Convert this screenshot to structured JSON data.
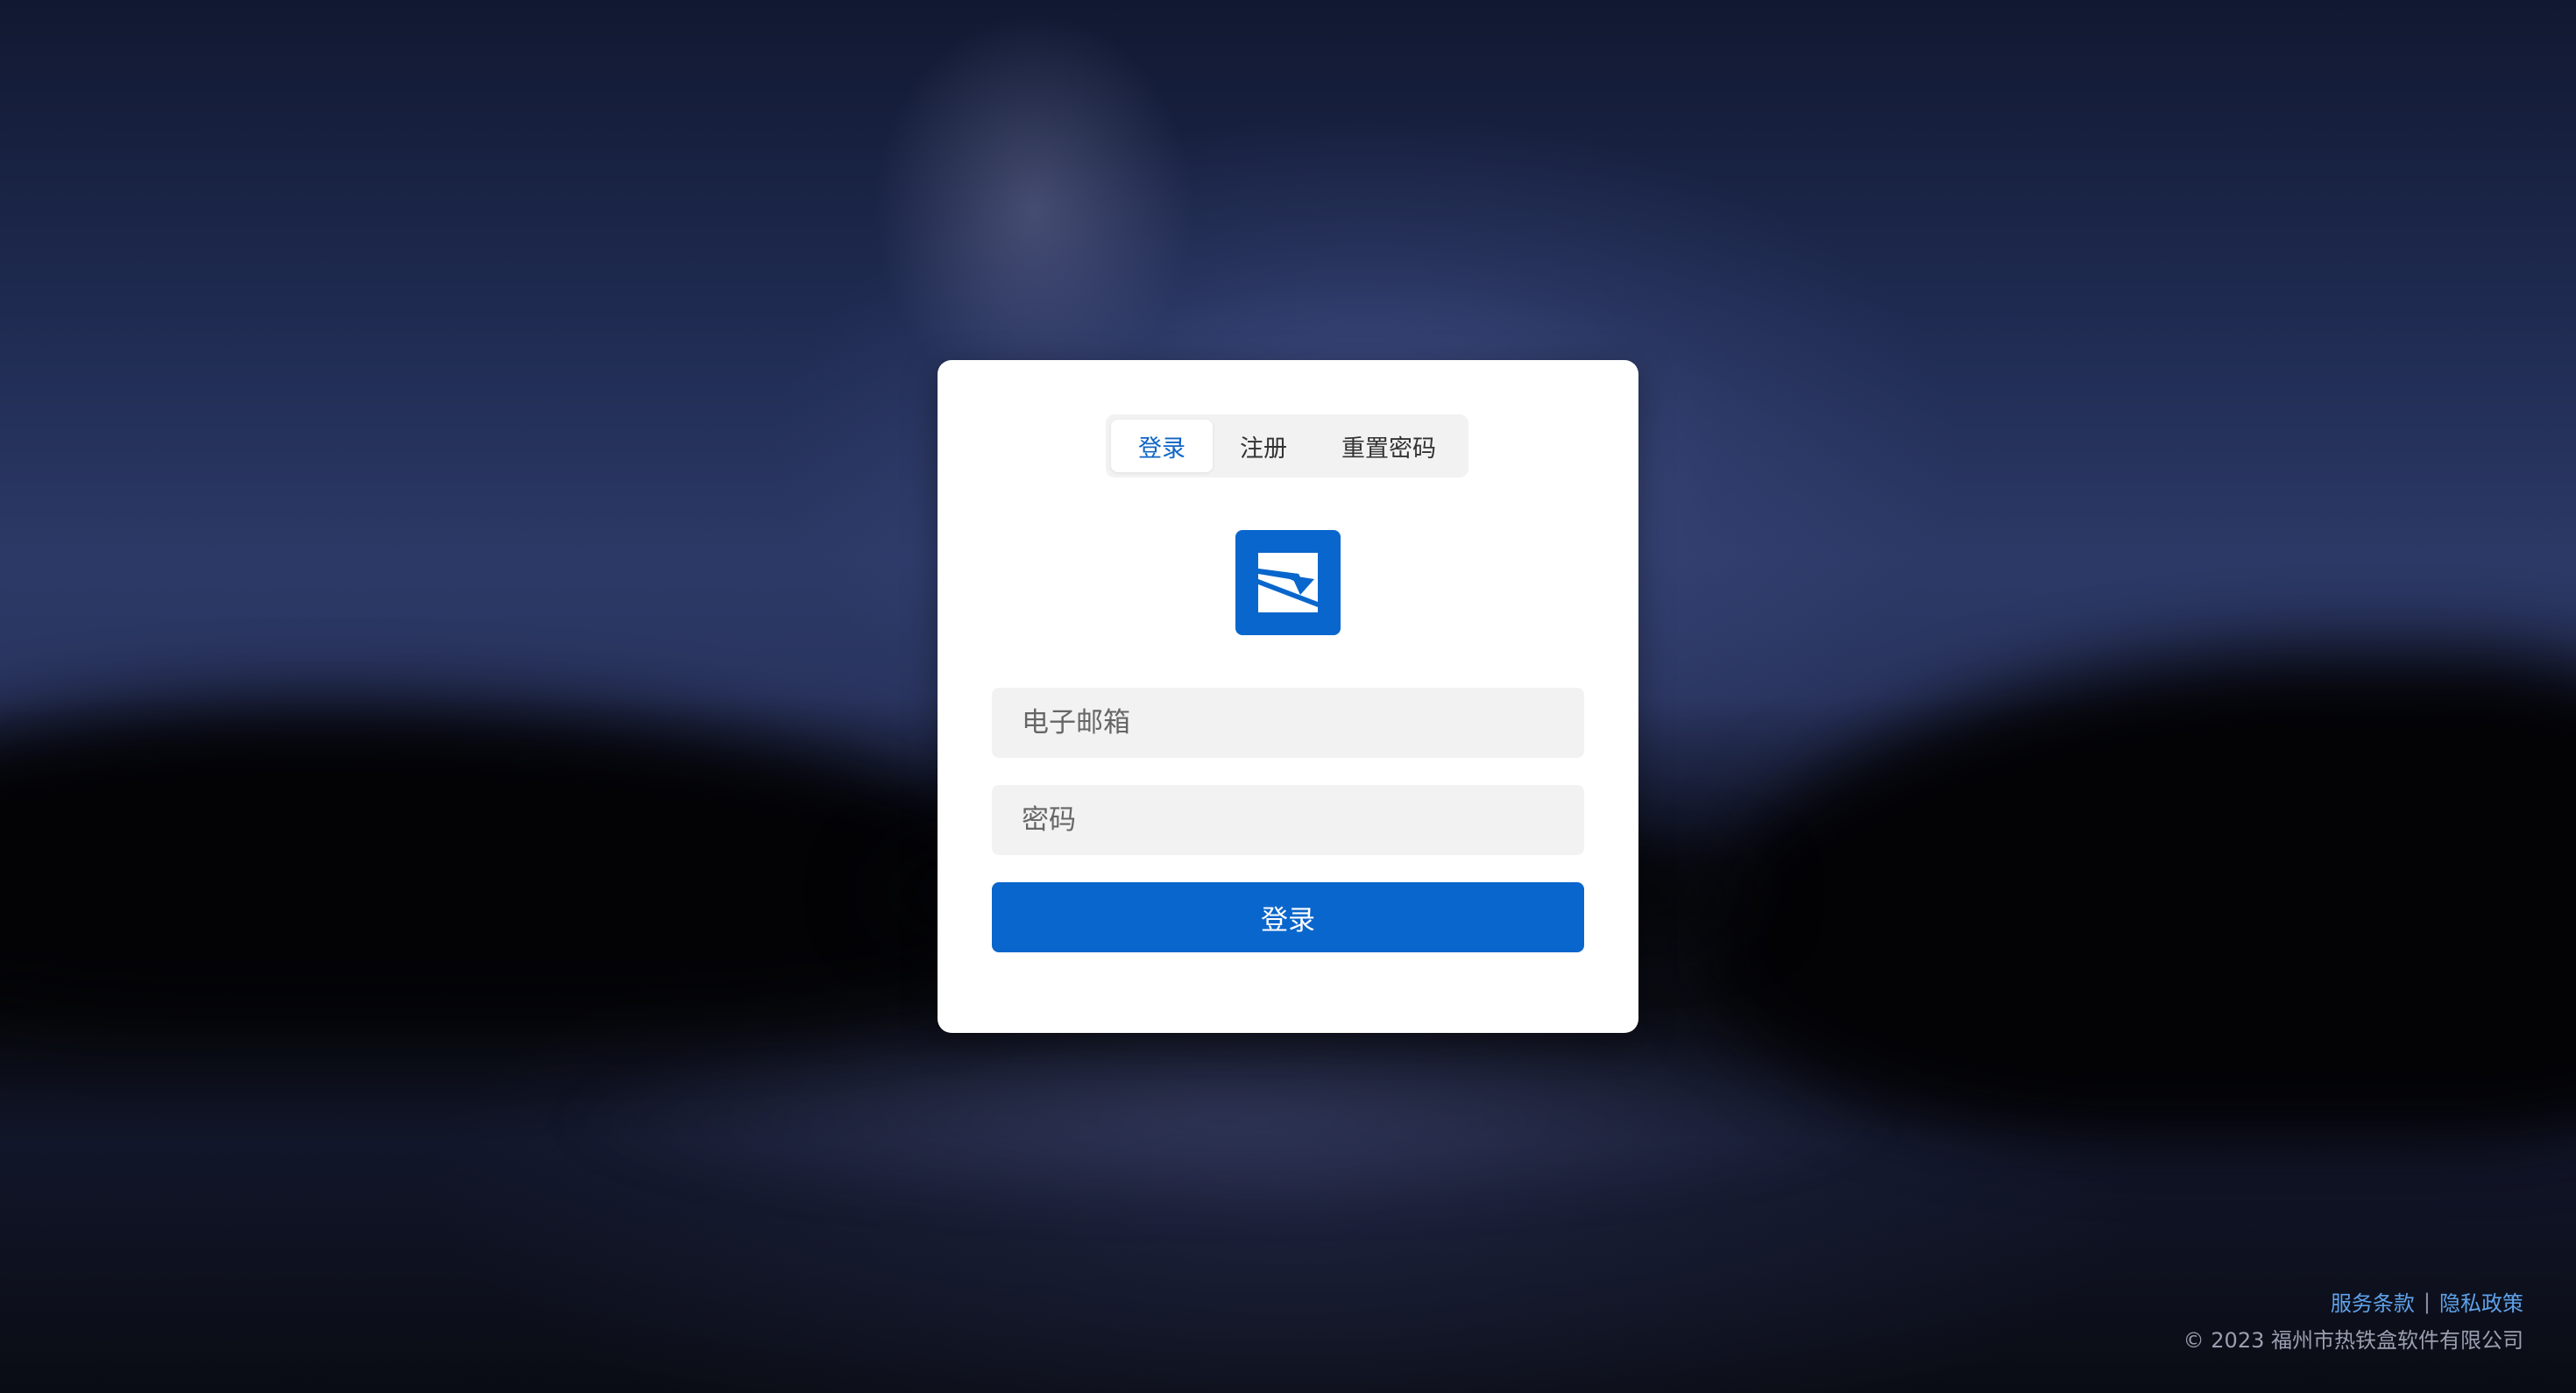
{
  "auth": {
    "tabs": [
      {
        "label": "登录",
        "active": true
      },
      {
        "label": "注册",
        "active": false
      },
      {
        "label": "重置密码",
        "active": false
      }
    ],
    "logo_icon": "envelope-logo-icon",
    "email_placeholder": "电子邮箱",
    "password_placeholder": "密码",
    "submit_label": "登录"
  },
  "footer": {
    "terms_label": "服务条款",
    "separator": "|",
    "privacy_label": "隐私政策",
    "copyright": "© 2023 福州市热铁盒软件有限公司"
  },
  "colors": {
    "accent": "#0966cc",
    "link": "#5ea2ea",
    "card_bg": "#ffffff",
    "field_bg": "#f2f2f2"
  }
}
